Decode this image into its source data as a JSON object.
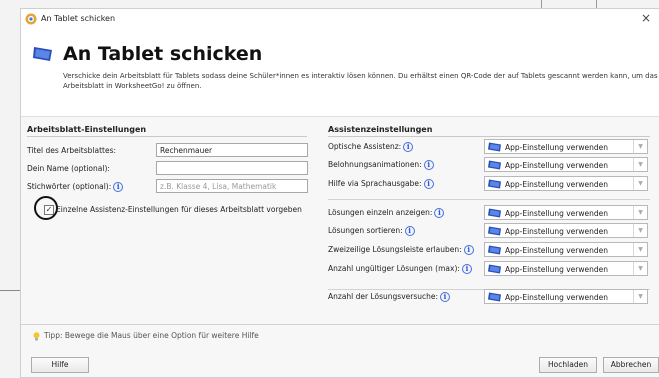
{
  "window": {
    "title": "An Tablet schicken",
    "close_glyph": "×"
  },
  "header": {
    "title": "An Tablet schicken",
    "description": "Verschicke dein Arbeitsblatt für Tablets sodass deine Schüler*innen es interaktiv lösen können. Du erhältst einen QR-Code der auf Tablets gescannt werden kann, um das Arbeitsblatt in WorksheetGo! zu öffnen."
  },
  "worksheet_settings": {
    "group_title": "Arbeitsblatt-Einstellungen",
    "title_label": "Titel des Arbeitsblattes:",
    "title_value": "Rechenmauer",
    "name_label": "Dein Name (optional):",
    "name_value": "",
    "keywords_label": "Stichwörter (optional):",
    "keywords_placeholder": "z.B. Klasse 4, Lisa, Mathematik",
    "individual_settings_label": "Einzelne Assistenz-Einstellungen für dieses Arbeitsblatt vorgeben",
    "individual_settings_checked": true
  },
  "assistant_settings": {
    "group_title": "Assistenzeinstellungen",
    "info_glyph": "i",
    "rows": [
      {
        "label": "Optische Assistenz:",
        "value": "App-Einstellung verwenden"
      },
      {
        "label": "Belohnungsanimationen:",
        "value": "App-Einstellung verwenden"
      },
      {
        "label": "Hilfe via Sprachausgabe:",
        "value": "App-Einstellung verwenden"
      },
      {
        "label": "Lösungen einzeln anzeigen:",
        "value": "App-Einstellung verwenden"
      },
      {
        "label": "Lösungen sortieren:",
        "value": "App-Einstellung verwenden"
      },
      {
        "label": "Zweizeilige Lösungsleiste erlauben:",
        "value": "App-Einstellung verwenden"
      },
      {
        "label": "Anzahl ungültiger Lösungen (max):",
        "value": "App-Einstellung verwenden"
      },
      {
        "label": "Anzahl der Lösungsversuche:",
        "value": "App-Einstellung verwenden"
      }
    ]
  },
  "footer": {
    "tip": "Tipp: Bewege die Maus über eine Option für weitere Hilfe",
    "help_button": "Hilfe",
    "upload_button": "Hochladen",
    "cancel_button": "Abbrechen"
  },
  "colors": {
    "accent": "#2e54c7",
    "tablet_icon": "#2a4fb8",
    "bulb": "#f2c531"
  },
  "icons": {
    "app": "worksheetcrafter-app-icon",
    "tablet": "tablet-icon",
    "info": "info-icon",
    "tip": "lightbulb-icon",
    "dropdown": "chevron-down-icon"
  }
}
